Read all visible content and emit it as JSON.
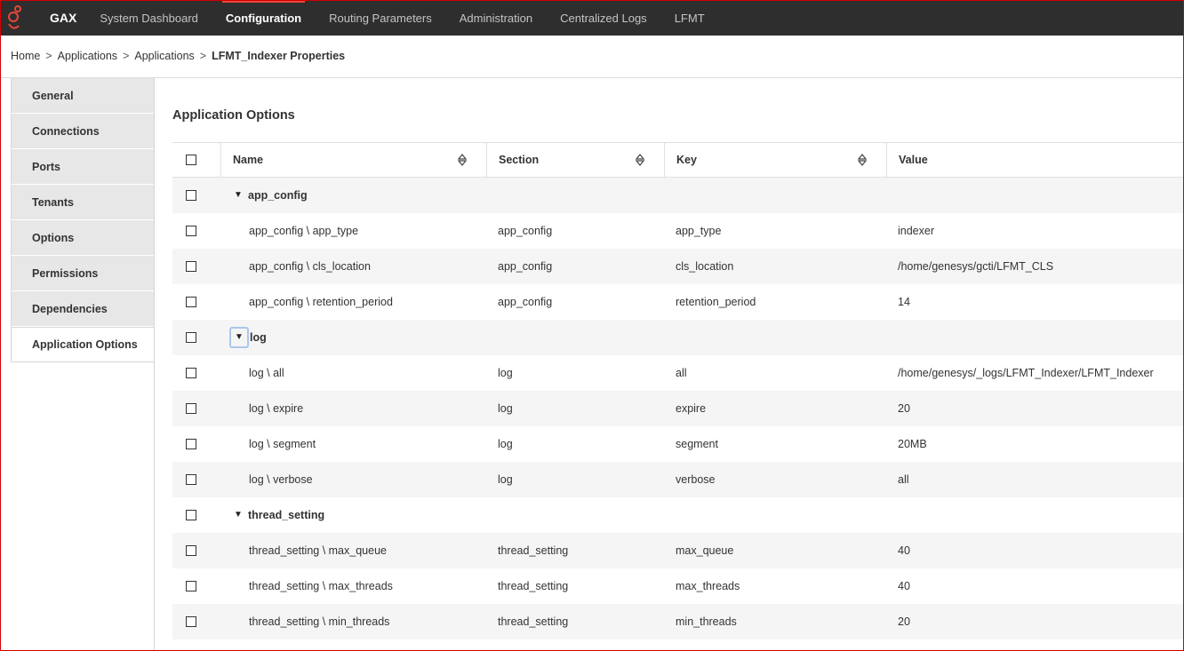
{
  "topnav": {
    "brand": "GAX",
    "items": [
      {
        "label": "System Dashboard",
        "active": false
      },
      {
        "label": "Configuration",
        "active": true
      },
      {
        "label": "Routing Parameters",
        "active": false
      },
      {
        "label": "Administration",
        "active": false
      },
      {
        "label": "Centralized Logs",
        "active": false
      },
      {
        "label": "LFMT",
        "active": false
      }
    ],
    "logo_icon": "genesys-logo-icon",
    "background": "#2e2e2e",
    "accent": "#e8463a"
  },
  "breadcrumb": {
    "items": [
      "Home",
      "Applications",
      "Applications"
    ],
    "separator": ">",
    "current": "LFMT_Indexer Properties"
  },
  "sidebar": {
    "items": [
      {
        "label": "General"
      },
      {
        "label": "Connections"
      },
      {
        "label": "Ports"
      },
      {
        "label": "Tenants"
      },
      {
        "label": "Options"
      },
      {
        "label": "Permissions"
      },
      {
        "label": "Dependencies"
      },
      {
        "label": "Application Options",
        "active": true
      }
    ]
  },
  "main": {
    "title": "Application Options",
    "table": {
      "columns": [
        "Name",
        "Section",
        "Key",
        "Value"
      ],
      "sort_icon": "sort-updown-icon",
      "rows": [
        {
          "type": "group",
          "name": "app_config"
        },
        {
          "type": "item",
          "name": "app_config \\ app_type",
          "section": "app_config",
          "key": "app_type",
          "value": "indexer"
        },
        {
          "type": "item",
          "name": "app_config \\ cls_location",
          "section": "app_config",
          "key": "cls_location",
          "value": "/home/genesys/gcti/LFMT_CLS"
        },
        {
          "type": "item",
          "name": "app_config \\ retention_period",
          "section": "app_config",
          "key": "retention_period",
          "value": "14"
        },
        {
          "type": "group",
          "name": "log",
          "focused": true
        },
        {
          "type": "item",
          "name": "log \\ all",
          "section": "log",
          "key": "all",
          "value": "/home/genesys/_logs/LFMT_Indexer/LFMT_Indexer"
        },
        {
          "type": "item",
          "name": "log \\ expire",
          "section": "log",
          "key": "expire",
          "value": "20"
        },
        {
          "type": "item",
          "name": "log \\ segment",
          "section": "log",
          "key": "segment",
          "value": "20MB"
        },
        {
          "type": "item",
          "name": "log \\ verbose",
          "section": "log",
          "key": "verbose",
          "value": "all"
        },
        {
          "type": "group",
          "name": "thread_setting"
        },
        {
          "type": "item",
          "name": "thread_setting \\ max_queue",
          "section": "thread_setting",
          "key": "max_queue",
          "value": "40"
        },
        {
          "type": "item",
          "name": "thread_setting \\ max_threads",
          "section": "thread_setting",
          "key": "max_threads",
          "value": "40"
        },
        {
          "type": "item",
          "name": "thread_setting \\ min_threads",
          "section": "thread_setting",
          "key": "min_threads",
          "value": "20"
        }
      ]
    }
  }
}
